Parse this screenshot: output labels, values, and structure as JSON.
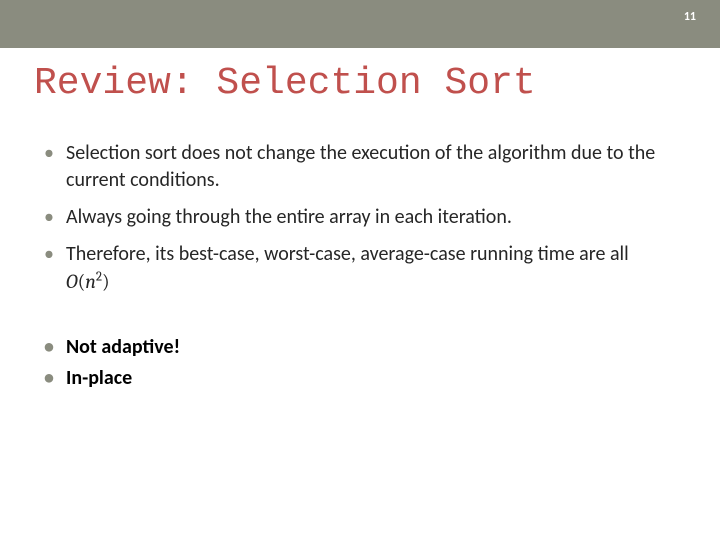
{
  "header": {
    "page_number": "11"
  },
  "title": "Review: Selection Sort",
  "bullets": {
    "b1": "Selection sort does not change the execution of the algorithm due to the current conditions.",
    "b2": "Always going through the entire array in each iteration.",
    "b3_pre": "Therefore, its best-case, worst-case, average-case running time are all ",
    "b3_math_O": "O",
    "b3_math_open": "(",
    "b3_math_n": "n",
    "b3_math_exp": "2",
    "b3_math_close": ")",
    "b4": "Not adaptive!",
    "b5": "In-place"
  }
}
